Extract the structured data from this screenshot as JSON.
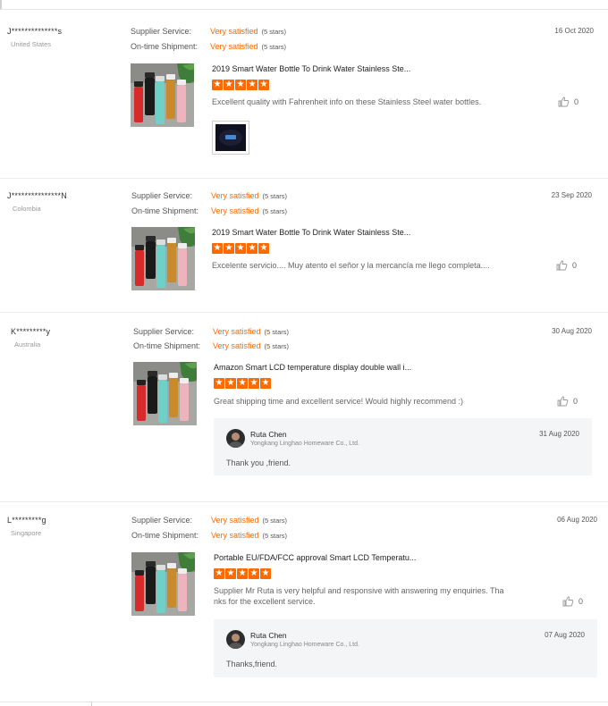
{
  "labels": {
    "supplier_service": "Supplier Service:",
    "on_time_shipment": "On-time Shipment:"
  },
  "colors": {
    "accent": "#ff6a00"
  },
  "reviews": [
    {
      "buyer": "J**************s",
      "country": "United States",
      "supplier_service": "Very satisfied",
      "supplier_stars": "(5 stars)",
      "on_time": "Very satisfied",
      "on_time_stars": "(5 stars)",
      "date": "16 Oct 2020",
      "product": "2019 Smart Water Bottle To Drink Water Stainless Ste...",
      "rating": 5,
      "text": "Excellent quality with Fahrenheit info on these Stainless Steel water bottles.",
      "likes": "0",
      "has_attachment": true
    },
    {
      "buyer": "J***************N",
      "country": "Colombia",
      "supplier_service": "Very satisfied",
      "supplier_stars": "(5 stars)",
      "on_time": "Very satisfied",
      "on_time_stars": "(5 stars)",
      "date": "23 Sep 2020",
      "product": "2019 Smart Water Bottle To Drink Water Stainless Ste...",
      "rating": 5,
      "text": "Excelente servicio.... Muy atento el señor y la mercancía me llego completa....",
      "likes": "0"
    },
    {
      "buyer": "K*********y",
      "country": "Australia",
      "supplier_service": "Very satisfied",
      "supplier_stars": "(5 stars)",
      "on_time": "Very satisfied",
      "on_time_stars": "(5 stars)",
      "date": "30 Aug 2020",
      "product": "Amazon Smart LCD temperature display double wall i...",
      "rating": 5,
      "text": "Great shipping time and excellent service! Would highly recommend :)",
      "likes": "0",
      "reply": {
        "name": "Ruta Chen",
        "company": "Yongkang Linghao Homeware Co., Ltd.",
        "date": "31 Aug 2020",
        "text": "Thank you ,friend."
      }
    },
    {
      "buyer": "L*********g",
      "country": "Singapore",
      "supplier_service": "Very satisfied",
      "supplier_stars": "(5 stars)",
      "on_time": "Very satisfied",
      "on_time_stars": "(5 stars)",
      "date": "06 Aug 2020",
      "product": "Portable EU/FDA/FCC approval Smart LCD Temperatu...",
      "rating": 5,
      "text_line1": "Supplier Mr Ruta is very helpful and responsive with answering my enquiries. Tha",
      "text_line2": "nks for the excellent service.",
      "likes": "0",
      "reply": {
        "name": "Ruta Chen",
        "company": "Yongkang Linghao Homeware Co., Ltd.",
        "date": "07 Aug 2020",
        "text": "Thanks,friend."
      }
    }
  ]
}
